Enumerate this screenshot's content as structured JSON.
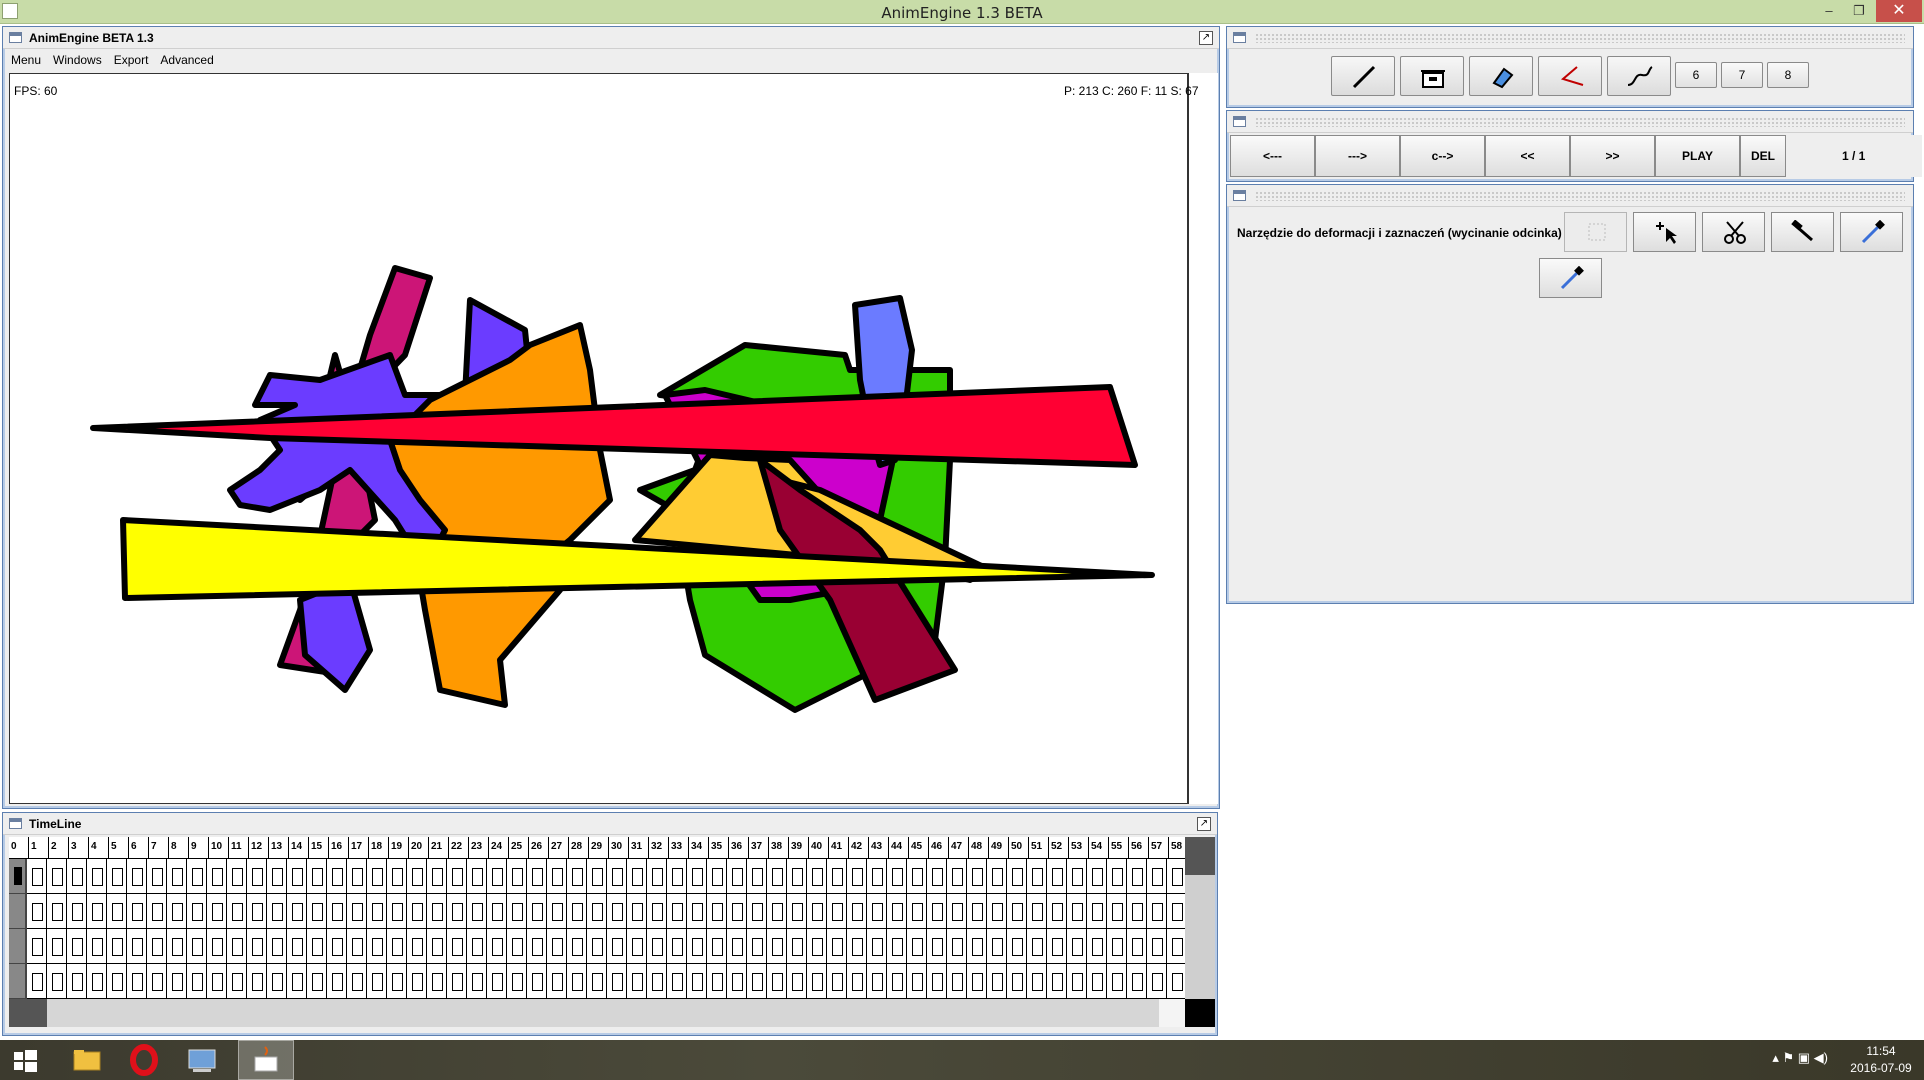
{
  "os": {
    "title": "AnimEngine 1.3 BETA",
    "minimize": "–",
    "restore": "❐",
    "close": "✕"
  },
  "main_frame": {
    "title": "AnimEngine BETA 1.3",
    "menu": [
      "Menu",
      "Windows",
      "Export",
      "Advanced"
    ],
    "fps": "FPS: 60",
    "stats": "P: 213 C: 260 F: 11 S: 67"
  },
  "tools_panel": {
    "numeric_buttons": [
      "6",
      "7",
      "8"
    ]
  },
  "playback_panel": {
    "buttons": [
      "<---",
      "--->",
      "c-->",
      "<<",
      ">>",
      "PLAY",
      "DEL"
    ],
    "frame_indicator": "1 / 1"
  },
  "deform_panel": {
    "label": "Narzędzie do deformacji i zaznaczeń (wycinanie odcinka)"
  },
  "timeline": {
    "title": "TimeLine",
    "frames": [
      "0",
      "1",
      "2",
      "3",
      "4",
      "5",
      "6",
      "7",
      "8",
      "9",
      "10",
      "11",
      "12",
      "13",
      "14",
      "15",
      "16",
      "17",
      "18",
      "19",
      "20",
      "21",
      "22",
      "23",
      "24",
      "25",
      "26",
      "27",
      "28",
      "29",
      "30",
      "31",
      "32",
      "33",
      "34",
      "35",
      "36",
      "37",
      "38",
      "39",
      "40",
      "41",
      "42",
      "43",
      "44",
      "45",
      "46",
      "47",
      "48",
      "49",
      "50",
      "51",
      "52",
      "53",
      "54",
      "55",
      "56",
      "57",
      "58"
    ],
    "active_layer": 0,
    "layers": 4
  },
  "taskbar": {
    "clock_time": "11:54",
    "clock_date": "2016-07-09",
    "items": [
      "start",
      "file-explorer",
      "opera",
      "control-panel",
      "java-app"
    ]
  }
}
